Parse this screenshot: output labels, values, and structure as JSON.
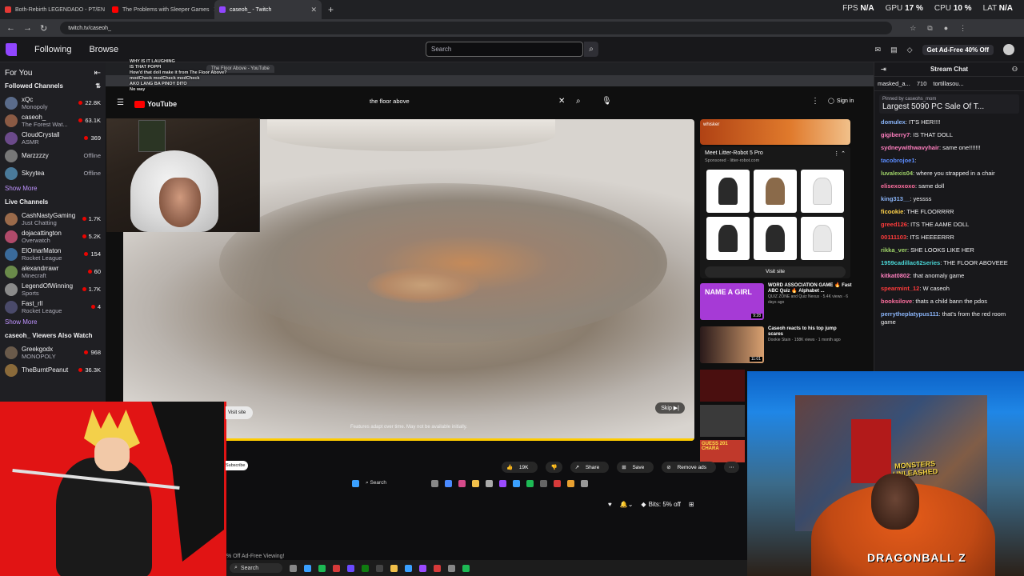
{
  "browser": {
    "tabs": [
      {
        "label": "Both-Rebirth LEGENDADO - PT/EN",
        "color": "#e53935"
      },
      {
        "label": "The Problems with Sleeper Games",
        "color": "#ff0000"
      },
      {
        "label": "caseoh_ - Twitch",
        "color": "#9146ff"
      }
    ],
    "url": "twitch.tv/caseoh_",
    "stats": {
      "fps_label": "FPS",
      "fps": "N/A",
      "gpu_label": "GPU",
      "gpu": "17 %",
      "cpu_label": "CPU",
      "cpu": "10 %",
      "lat_label": "LAT",
      "lat": "N/A"
    }
  },
  "twitch_nav": {
    "following": "Following",
    "browse": "Browse",
    "search_placeholder": "Search",
    "ad_free": "Get Ad-Free 40% Off"
  },
  "sidebar": {
    "for_you": "For You",
    "followed_title": "Followed Channels",
    "followed": [
      {
        "name": "xQc",
        "game": "Monopoly",
        "viewers": "22.8K",
        "color": "#5a6b8a"
      },
      {
        "name": "caseoh_",
        "game": "The Forest Wat...",
        "viewers": "63.1K",
        "color": "#8a5a44"
      },
      {
        "name": "CloudCrystall",
        "game": "ASMR",
        "viewers": "369",
        "color": "#6b4a8a"
      },
      {
        "name": "Marzzzzy",
        "game": "",
        "viewers": "Offline",
        "color": "#777777"
      },
      {
        "name": "Skyytea",
        "game": "",
        "viewers": "Offline",
        "color": "#4a7a9a"
      }
    ],
    "show_more": "Show More",
    "live_title": "Live Channels",
    "live": [
      {
        "name": "CashNastyGaming",
        "game": "Just Chatting",
        "viewers": "1.7K",
        "color": "#9a6a4a"
      },
      {
        "name": "dojacattington",
        "game": "Overwatch",
        "viewers": "5.2K",
        "color": "#b04a6a"
      },
      {
        "name": "ElOmarMaton",
        "game": "Rocket League",
        "viewers": "154",
        "color": "#3a6a9a"
      },
      {
        "name": "alexandrrawr",
        "game": "Minecraft",
        "viewers": "60",
        "color": "#6a8a4a"
      },
      {
        "name": "LegendOfWinning",
        "game": "Sports",
        "viewers": "1.7K",
        "color": "#8a8a8a"
      },
      {
        "name": "Fast_rll",
        "game": "Rocket League",
        "viewers": "4",
        "color": "#4a4a6a"
      }
    ],
    "show_more2": "Show More",
    "viewers_watch": "caseoh_ Viewers Also Watch",
    "also": [
      {
        "name": "Greekgodx",
        "game": "MONOPOLY",
        "viewers": "968",
        "color": "#6a5a4a"
      },
      {
        "name": "TheBurntPeanut",
        "game": "",
        "viewers": "36.3K",
        "color": "#8a6a3a"
      }
    ]
  },
  "youtube": {
    "tab1": "The Floor Above - YouTube",
    "chat_overlay": [
      "WHY IS IT LAUGHING",
      "IS THAT POPPI",
      "How'd that doll make it from The Floor Above?",
      "modCheck modCheck modCheck",
      "AKO LANG BA PINOY DITO",
      "No way"
    ],
    "logo": "YouTube",
    "query": "the floor above",
    "sign_in": "Sign in",
    "video_caption": "Features adapt over time. May not be available initially.",
    "skip": "Skip",
    "ad_brand": "whisker",
    "ad_title": "Meet Litter-Robot 5 Pro",
    "ad_sponsored": "Sponsored · litter-robot.com",
    "visit_site": "Visit site",
    "visit_site_short": "Visit site",
    "subscribe_short": "Subscribe",
    "recs": [
      {
        "title": "WORD ASSOCIATION GAME 🔥 Fast ABC Quiz 🔥 Alphabet ...",
        "meta": "QUIZ ZONE and Quiz Nexus · 5.4K views · 6 days ago",
        "color": "#a63ad6",
        "badge": "NAME A GIRL",
        "duration": "9:28"
      },
      {
        "title": "Caseoh reacts to his top jump scares",
        "meta": "Dookie Stain · 158K views · 1 month ago",
        "color": "#3a2a2a",
        "badge": "",
        "duration": "11:01"
      }
    ],
    "actions": {
      "likes": "19K",
      "share": "Share",
      "save": "Save",
      "remove_ads": "Remove ads"
    },
    "guess_banner": "GUESS 201 CHARA",
    "taskbar_search": "Search"
  },
  "chat": {
    "title": "Stream Chat",
    "leaders": [
      {
        "name": "masked_a...",
        "count": ""
      },
      {
        "name": "710",
        "count": ""
      },
      {
        "name": "tortillasou...",
        "count": ""
      }
    ],
    "pinned_by": "Pinned by caseohs_mom",
    "pinned_msg": "Largest 5090 PC Sale Of T...",
    "messages": [
      {
        "user": "domulex",
        "text": "IT'S HER!!!!",
        "color": "#8ab4f8"
      },
      {
        "user": "gigiberry7",
        "text": "IS THAT DOLL",
        "color": "#ff7fbf"
      },
      {
        "user": "sydneywithwavyhair",
        "text": "same one!!!!!!!",
        "color": "#ff7fbf"
      },
      {
        "user": "tacobrojoe1",
        "text": "",
        "color": "#5b8cff"
      },
      {
        "user": "luvalexis04",
        "text": "where you strapped in a chair",
        "color": "#a0d468"
      },
      {
        "user": "elisexoxoxo",
        "text": "same doll",
        "color": "#ff6fa0"
      },
      {
        "user": "king313__",
        "text": "yessss",
        "color": "#8ab4f8"
      },
      {
        "user": "ficookie",
        "text": "THE FLOORRRR",
        "color": "#ffd24a"
      },
      {
        "user": "greed126",
        "text": "ITS THE AAME DOLL",
        "color": "#ff3b3b"
      },
      {
        "user": "00111103",
        "text": "ITS HEEEERRR",
        "color": "#ff3b3b"
      },
      {
        "user": "rikka_ver",
        "text": "SHE LOOKS LIKE HER",
        "color": "#a0d468"
      },
      {
        "user": "1959cadillac62series",
        "text": "THE FLOOR ABOVEEE",
        "color": "#4ad6d6"
      },
      {
        "user": "kitkat0802",
        "text": "that anomaly game",
        "color": "#ff7fbf"
      },
      {
        "user": "spearmint_12",
        "text": "W caseoh",
        "color": "#ff3b3b"
      },
      {
        "user": "booksilove",
        "text": "thats a child bann the pdos",
        "color": "#ff6fa0"
      },
      {
        "user": "perrytheplatypus111",
        "text": "that's from the red room game",
        "color": "#8ab4f8"
      }
    ]
  },
  "bottom": {
    "bits": "Bits: 5% off",
    "ad_free_viewing": "% Off Ad-Free Viewing!"
  },
  "webcam": {
    "poster_text": "MONSTERS UNLEASHED",
    "shirt_text": "DRAGONBALL Z"
  }
}
